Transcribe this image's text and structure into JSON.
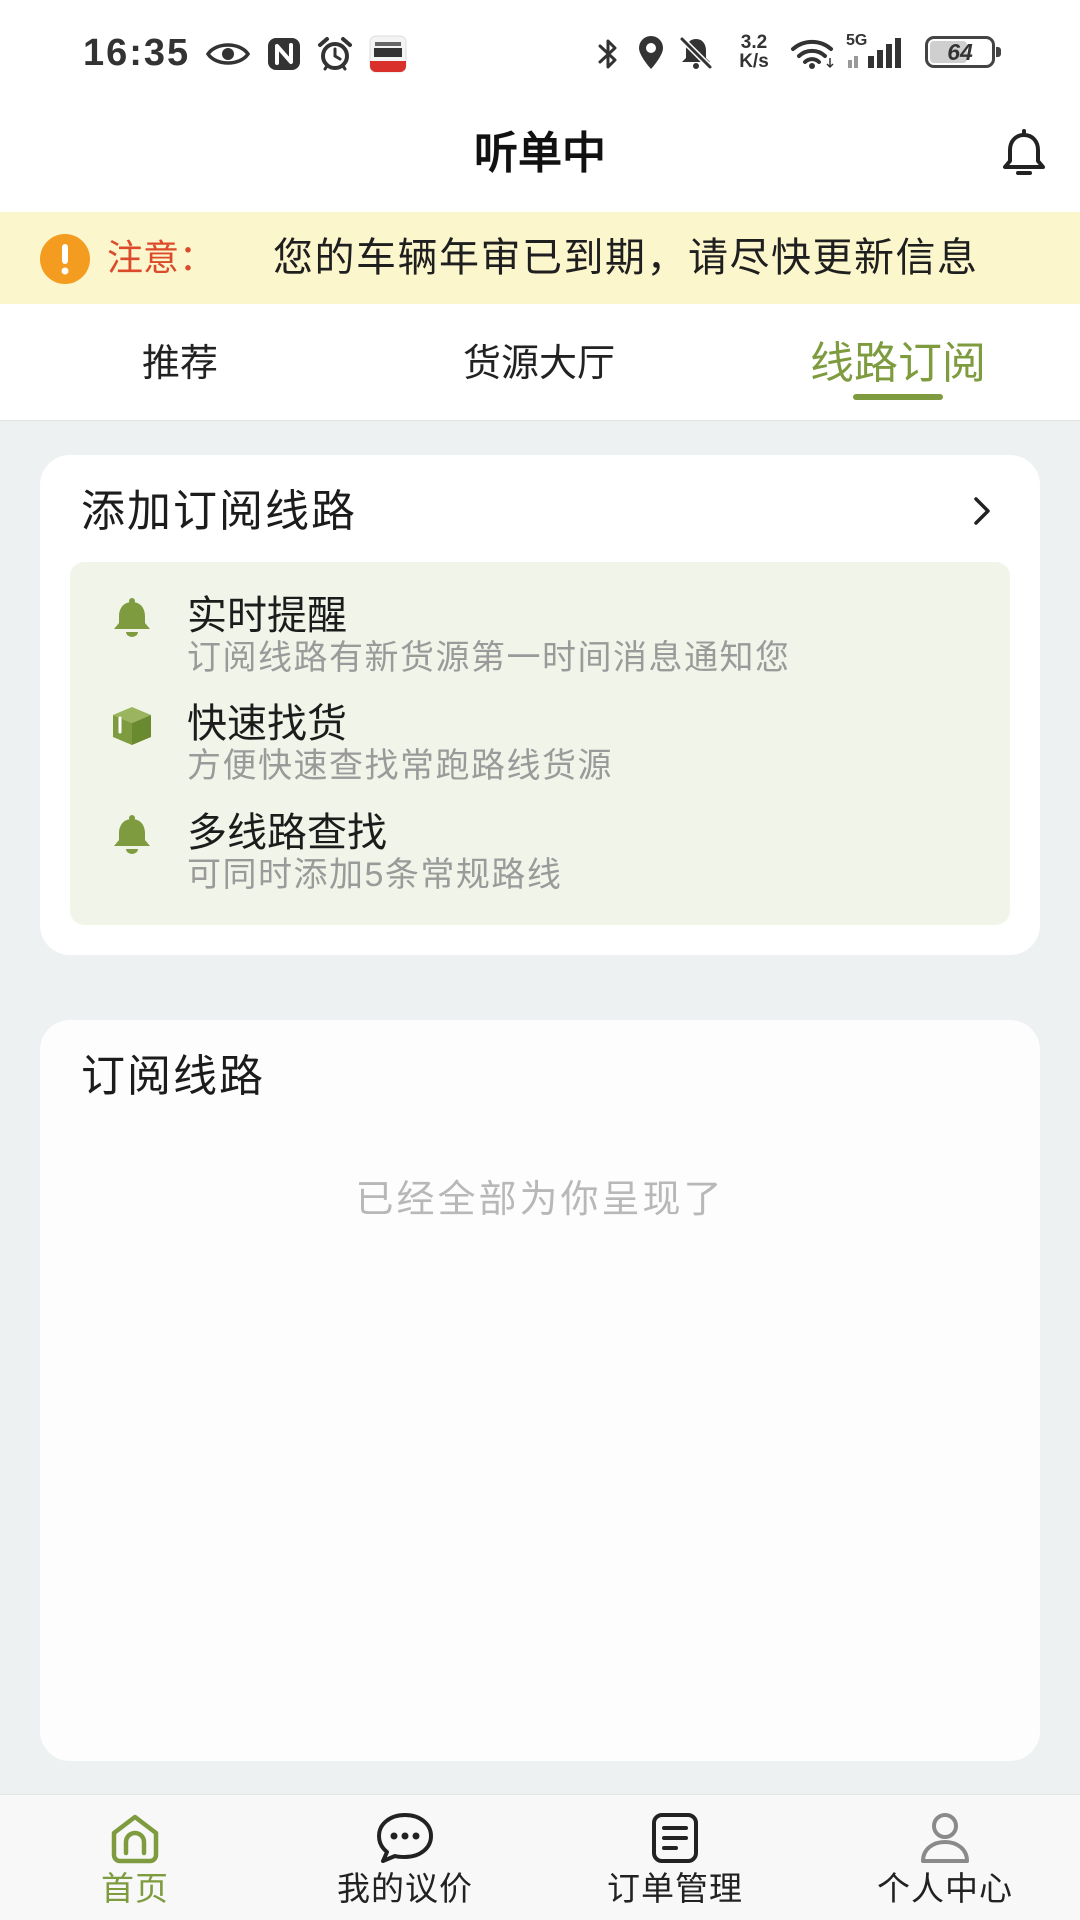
{
  "status_bar": {
    "time": "16:35",
    "left_icons": [
      "eye-icon",
      "nfc-icon",
      "alarm-icon",
      "app-notification-icon"
    ],
    "right_icons": [
      "bluetooth-icon",
      "location-icon",
      "notifications-off-icon",
      "wifi-icon",
      "signal-icon",
      "battery-icon"
    ],
    "net_speed_value": "3.2",
    "net_speed_unit": "K/s",
    "network_type": "5G",
    "battery": "64"
  },
  "header": {
    "title": "听单中",
    "bell_icon": "bell-icon"
  },
  "notice": {
    "icon": "exclamation-circle-icon",
    "label": "注意：",
    "message": "您的车辆年审已到期，请尽快更新信息"
  },
  "tabs": [
    {
      "label": "推荐",
      "active": false
    },
    {
      "label": "货源大厅",
      "active": false
    },
    {
      "label": "线路订阅",
      "active": true
    }
  ],
  "add_card": {
    "title": "添加订阅线路",
    "arrow_icon": "chevron-right-icon",
    "features": [
      {
        "icon": "bell-icon",
        "title": "实时提醒",
        "desc": "订阅线路有新货源第一时间消息通知您"
      },
      {
        "icon": "box-icon",
        "title": "快速找货",
        "desc": "方便快速查找常跑路线货源"
      },
      {
        "icon": "bell-icon",
        "title": "多线路查找",
        "desc": "可同时添加5条常规路线"
      }
    ]
  },
  "subscribed_card": {
    "title": "订阅线路",
    "empty_text": "已经全部为你呈现了"
  },
  "bottom_nav": [
    {
      "label": "首页",
      "icon": "home-icon",
      "active": true
    },
    {
      "label": "我的议价",
      "icon": "chat-icon",
      "active": false
    },
    {
      "label": "订单管理",
      "icon": "order-list-icon",
      "active": false
    },
    {
      "label": "个人中心",
      "icon": "user-icon",
      "active": false
    }
  ],
  "colors": {
    "accent": "#7e9c3f",
    "notice_background": "#fbf6cc",
    "notice_label": "#dc4a2c",
    "warning_icon": "#f39c1f",
    "page_background": "#eef1f2",
    "feature_panel": "#f1f5e9",
    "muted_text": "#9a9a9a"
  }
}
